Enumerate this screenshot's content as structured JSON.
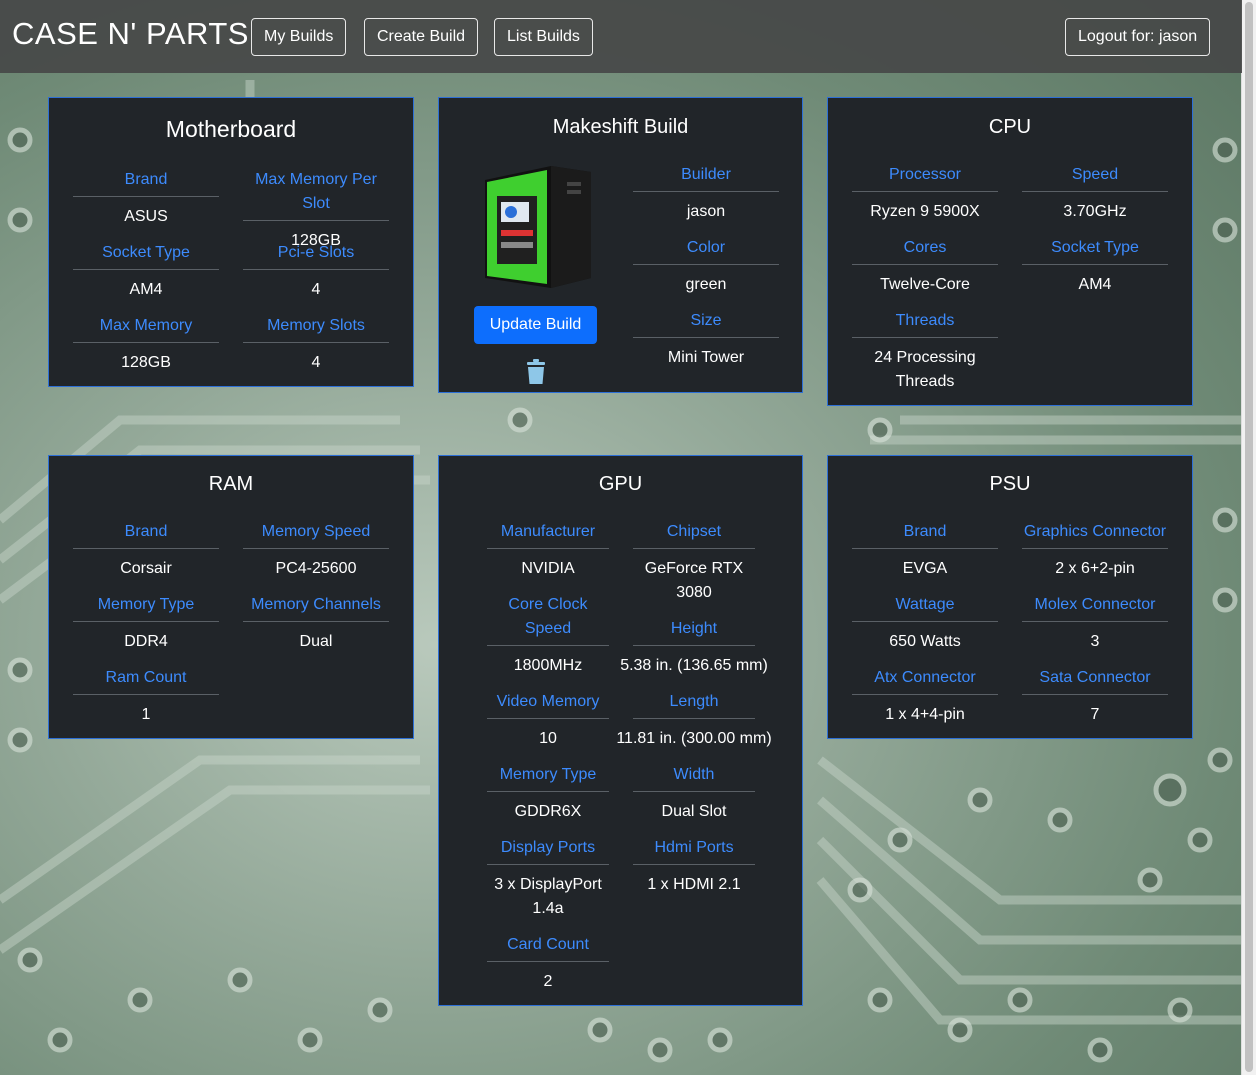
{
  "navbar": {
    "brand": "CASE N' PARTS",
    "buttons": [
      "My Builds",
      "Create Build",
      "List Builds"
    ],
    "logout": "Logout for: jason"
  },
  "motherboard": {
    "title": "Motherboard",
    "fields": [
      {
        "label": "Brand",
        "value": "ASUS"
      },
      {
        "label": "Max Memory Per Slot",
        "value": "128GB"
      },
      {
        "label": "Socket Type",
        "value": "AM4"
      },
      {
        "label": "Pci-e Slots",
        "value": "4"
      },
      {
        "label": "Max Memory",
        "value": "128GB"
      },
      {
        "label": "Memory Slots",
        "value": "4"
      }
    ]
  },
  "build": {
    "title": "Makeshift Build",
    "update_label": "Update Build",
    "fields": [
      {
        "label": "Builder",
        "value": "jason"
      },
      {
        "label": "Color",
        "value": "green"
      },
      {
        "label": "Size",
        "value": "Mini Tower"
      }
    ]
  },
  "cpu": {
    "title": "CPU",
    "fields": [
      {
        "label": "Processor",
        "value": "Ryzen 9 5900X"
      },
      {
        "label": "Speed",
        "value": "3.70GHz"
      },
      {
        "label": "Cores",
        "value": "Twelve-Core"
      },
      {
        "label": "Socket Type",
        "value": "AM4"
      },
      {
        "label": "Threads",
        "value": "24 Processing Threads"
      }
    ]
  },
  "ram": {
    "title": "RAM",
    "fields": [
      {
        "label": "Brand",
        "value": "Corsair"
      },
      {
        "label": "Memory Speed",
        "value": "PC4-25600"
      },
      {
        "label": "Memory Type",
        "value": "DDR4"
      },
      {
        "label": "Memory Channels",
        "value": "Dual"
      },
      {
        "label": "Ram Count",
        "value": "1"
      }
    ]
  },
  "gpu": {
    "title": "GPU",
    "fields": [
      {
        "label": "Manufacturer",
        "value": "NVIDIA"
      },
      {
        "label": "Chipset",
        "value": "GeForce RTX 3080"
      },
      {
        "label": "Core Clock Speed",
        "value": "1800MHz"
      },
      {
        "label": "Height",
        "value": "5.38 in. (136.65 mm)"
      },
      {
        "label": "Video Memory",
        "value": "10"
      },
      {
        "label": "Length",
        "value": "11.81 in. (300.00 mm)"
      },
      {
        "label": "Memory Type",
        "value": "GDDR6X"
      },
      {
        "label": "Width",
        "value": "Dual Slot"
      },
      {
        "label": "Display Ports",
        "value": "3 x DisplayPort 1.4a"
      },
      {
        "label": "Hdmi Ports",
        "value": "1 x HDMI 2.1"
      },
      {
        "label": "Card Count",
        "value": "2"
      }
    ]
  },
  "psu": {
    "title": "PSU",
    "fields": [
      {
        "label": "Brand",
        "value": "EVGA"
      },
      {
        "label": "Graphics Connector",
        "value": "2 x 6+2-pin"
      },
      {
        "label": "Wattage",
        "value": "650 Watts"
      },
      {
        "label": "Molex Connector",
        "value": "3"
      },
      {
        "label": "Atx Connector",
        "value": "1 x 4+4-pin"
      },
      {
        "label": "Sata Connector",
        "value": "7"
      }
    ]
  }
}
